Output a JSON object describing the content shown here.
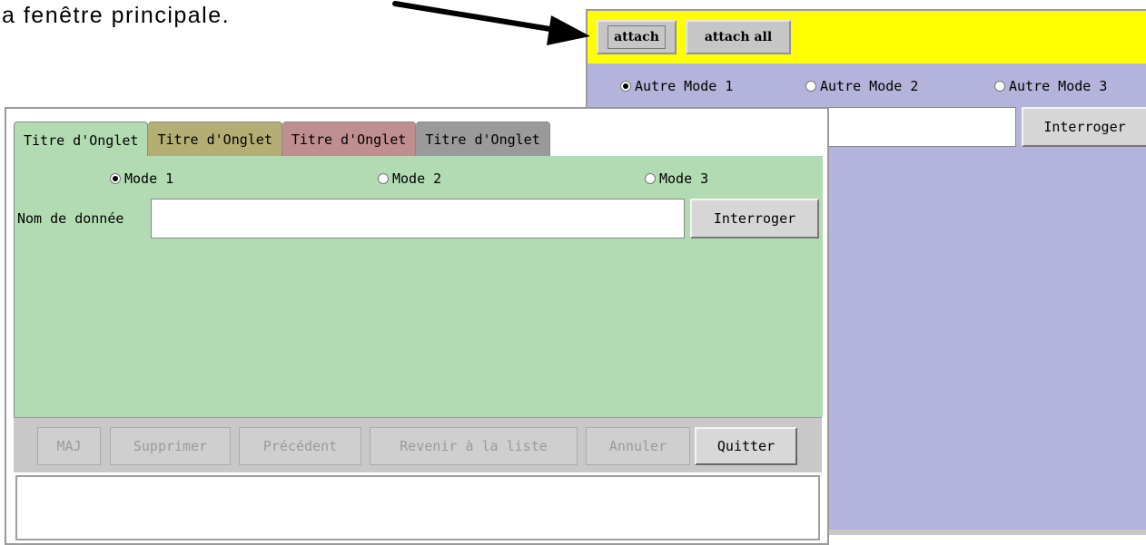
{
  "caption": {
    "text": "a fenêtre principale."
  },
  "main_window": {
    "toolbar": {
      "attach_label": "attach",
      "attach_all_label": "attach all",
      "color": "#ffff00"
    },
    "modes": [
      {
        "label": "Autre Mode 1",
        "selected": true
      },
      {
        "label": "Autre Mode 2",
        "selected": false
      },
      {
        "label": "Autre Mode 3",
        "selected": false
      }
    ],
    "query_button": "Interroger",
    "background_color": "#b3b3db"
  },
  "tab_window": {
    "tabs": [
      {
        "label": "Titre d'Onglet",
        "color": "#b3dbb3",
        "active": true
      },
      {
        "label": "Titre d'Onglet",
        "color": "#b3ae73",
        "active": false
      },
      {
        "label": "Titre d'Onglet",
        "color": "#c08e8e",
        "active": false
      },
      {
        "label": "Titre d'Onglet",
        "color": "#9a9a9a",
        "active": false
      }
    ],
    "modes": [
      {
        "label": "Mode 1",
        "selected": true
      },
      {
        "label": "Mode 2",
        "selected": false
      },
      {
        "label": "Mode 3",
        "selected": false
      }
    ],
    "data_field": {
      "label": "Nom de donnée",
      "value": ""
    },
    "query_button": "Interroger",
    "actions": {
      "update": "MAJ",
      "delete": "Supprimer",
      "previous": "Précédent",
      "back_to_list": "Revenir à la liste",
      "cancel": "Annuler",
      "quit": "Quitter"
    },
    "status_text": ""
  }
}
